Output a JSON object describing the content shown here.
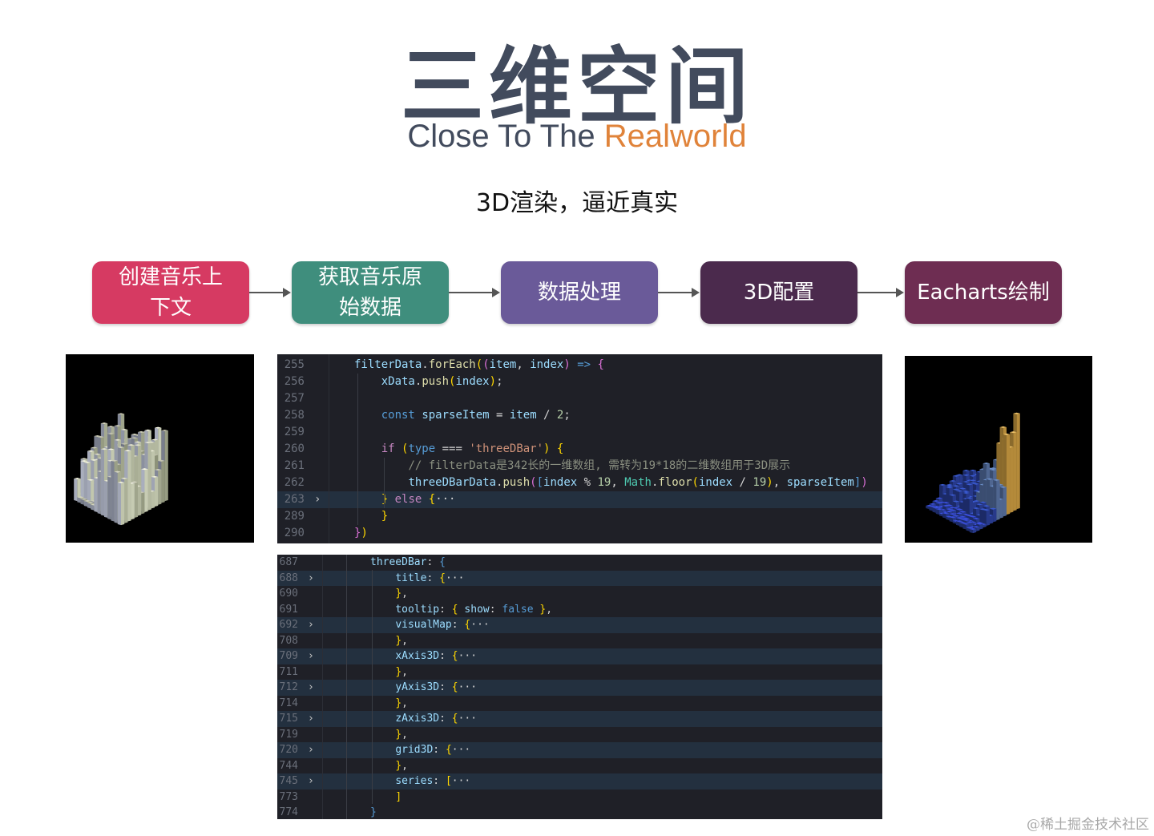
{
  "title": {
    "main": "三维空间",
    "sub_part1": "Close To The ",
    "sub_part2": "Realworld"
  },
  "tagline": "3D渲染，逼近真实",
  "flow": [
    {
      "label": "创建音乐上\n下文",
      "color": "#d63a62"
    },
    {
      "label": "获取音乐原\n始数据",
      "color": "#3f8e7d"
    },
    {
      "label": "数据处理",
      "color": "#6a5a99"
    },
    {
      "label": "3D配置",
      "color": "#4b2a4d"
    },
    {
      "label": "Eacharts绘制",
      "color": "#6e2d52"
    }
  ],
  "code1": {
    "lines": [
      {
        "n": "255",
        "chev": "",
        "hl": false,
        "html": "<span class='c-var'>filterData</span><span class='c-pn'>.</span><span class='c-fn'>forEach</span><span class='c-br'>(</span><span class='c-br2'>(</span><span class='c-var'>item</span><span class='c-pn'>, </span><span class='c-var'>index</span><span class='c-br2'>)</span><span class='c-pn'> </span><span class='c-blue'>=&gt;</span><span class='c-pn'> </span><span class='c-br2'>{</span>"
      },
      {
        "n": "256",
        "chev": "",
        "hl": false,
        "html": "    <span class='c-var'>xData</span><span class='c-pn'>.</span><span class='c-fn'>push</span><span class='c-br'>(</span><span class='c-var'>index</span><span class='c-br'>)</span><span class='c-pn'>;</span>"
      },
      {
        "n": "257",
        "chev": "",
        "hl": false,
        "html": ""
      },
      {
        "n": "258",
        "chev": "",
        "hl": false,
        "html": "    <span class='c-blue'>const</span><span class='c-pn'> </span><span class='c-var'>sparseItem</span><span class='c-pn'> = </span><span class='c-var'>item</span><span class='c-pn'> / </span><span class='c-num'>2</span><span class='c-pn'>;</span>"
      },
      {
        "n": "259",
        "chev": "",
        "hl": false,
        "html": ""
      },
      {
        "n": "260",
        "chev": "",
        "hl": false,
        "html": "    <span class='c-kw'>if</span><span class='c-pn'> </span><span class='c-br'>(</span><span class='c-blue'>type</span><span class='c-pn'> === </span><span class='c-st'>'threeDBar'</span><span class='c-br'>)</span><span class='c-pn'> </span><span class='c-br'>{</span>"
      },
      {
        "n": "261",
        "chev": "",
        "hl": false,
        "html": "        <span class='c-cm'>// filterData是342长的一维数组, 需转为19*18的二维数组用于3D展示</span>"
      },
      {
        "n": "262",
        "chev": "",
        "hl": false,
        "html": "        <span class='c-var'>threeDBarData</span><span class='c-pn'>.</span><span class='c-fn'>push</span><span class='c-br2'>(</span><span class='c-blue'>[</span><span class='c-var'>index</span><span class='c-pn'> % </span><span class='c-num'>19</span><span class='c-pn'>, </span><span class='c-ty'>Math</span><span class='c-pn'>.</span><span class='c-fn'>floor</span><span class='c-br'>(</span><span class='c-var'>index</span><span class='c-pn'> / </span><span class='c-num'>19</span><span class='c-br'>)</span><span class='c-pn'>, </span><span class='c-var'>sparseItem</span><span class='c-blue'>]</span><span class='c-br2'>)</span>"
      },
      {
        "n": "263",
        "chev": "›",
        "hl": true,
        "html": "    <span class='c-br'>}</span><span class='c-pn'> </span><span class='c-kw'>else</span><span class='c-pn'> </span><span class='c-br'>{</span><span class='c-pn'>···</span>"
      },
      {
        "n": "289",
        "chev": "",
        "hl": false,
        "html": "    <span class='c-br'>}</span>"
      },
      {
        "n": "290",
        "chev": "",
        "hl": false,
        "html": "<span class='c-br2'>}</span><span class='c-br'>)</span>"
      }
    ]
  },
  "code2": {
    "lines": [
      {
        "n": "687",
        "chev": "",
        "hl": false,
        "html": "<span class='c-var'>threeDBar</span><span class='c-pn'>: </span><span class='c-blue'>{</span>"
      },
      {
        "n": "688",
        "chev": "›",
        "hl": true,
        "html": "    <span class='c-var'>title</span><span class='c-pn'>: </span><span class='c-br'>{</span><span class='c-pn'>···</span>"
      },
      {
        "n": "690",
        "chev": "",
        "hl": false,
        "html": "    <span class='c-br'>}</span><span class='c-pn'>,</span>"
      },
      {
        "n": "691",
        "chev": "",
        "hl": false,
        "html": "    <span class='c-var'>tooltip</span><span class='c-pn'>: </span><span class='c-br'>{</span><span class='c-pn'> </span><span class='c-var'>show</span><span class='c-pn'>: </span><span class='c-blue'>false</span><span class='c-pn'> </span><span class='c-br'>}</span><span class='c-pn'>,</span>"
      },
      {
        "n": "692",
        "chev": "›",
        "hl": true,
        "html": "    <span class='c-var'>visualMap</span><span class='c-pn'>: </span><span class='c-br'>{</span><span class='c-pn'>···</span>"
      },
      {
        "n": "708",
        "chev": "",
        "hl": false,
        "html": "    <span class='c-br'>}</span><span class='c-pn'>,</span>"
      },
      {
        "n": "709",
        "chev": "›",
        "hl": true,
        "html": "    <span class='c-var'>xAxis3D</span><span class='c-pn'>: </span><span class='c-br'>{</span><span class='c-pn'>···</span>"
      },
      {
        "n": "711",
        "chev": "",
        "hl": false,
        "html": "    <span class='c-br'>}</span><span class='c-pn'>,</span>"
      },
      {
        "n": "712",
        "chev": "›",
        "hl": true,
        "html": "    <span class='c-var'>yAxis3D</span><span class='c-pn'>: </span><span class='c-br'>{</span><span class='c-pn'>···</span>"
      },
      {
        "n": "714",
        "chev": "",
        "hl": false,
        "html": "    <span class='c-br'>}</span><span class='c-pn'>,</span>"
      },
      {
        "n": "715",
        "chev": "›",
        "hl": true,
        "html": "    <span class='c-var'>zAxis3D</span><span class='c-pn'>: </span><span class='c-br'>{</span><span class='c-pn'>···</span>"
      },
      {
        "n": "719",
        "chev": "",
        "hl": false,
        "html": "    <span class='c-br'>}</span><span class='c-pn'>,</span>"
      },
      {
        "n": "720",
        "chev": "›",
        "hl": true,
        "html": "    <span class='c-var'>grid3D</span><span class='c-pn'>: </span><span class='c-br'>{</span><span class='c-pn'>···</span>"
      },
      {
        "n": "744",
        "chev": "",
        "hl": false,
        "html": "    <span class='c-br'>}</span><span class='c-pn'>,</span>"
      },
      {
        "n": "745",
        "chev": "›",
        "hl": true,
        "html": "    <span class='c-var'>series</span><span class='c-pn'>: </span><span class='c-br'>[</span><span class='c-pn'>···</span>"
      },
      {
        "n": "773",
        "chev": "",
        "hl": false,
        "html": "    <span class='c-br'>]</span>"
      },
      {
        "n": "774",
        "chev": "",
        "hl": false,
        "html": "<span class='c-blue'>}</span>"
      }
    ]
  },
  "images": {
    "left": "3d-bar-chart-beige",
    "right": "3d-bar-chart-blue-yellow"
  },
  "watermark": "@稀土掘金技术社区"
}
